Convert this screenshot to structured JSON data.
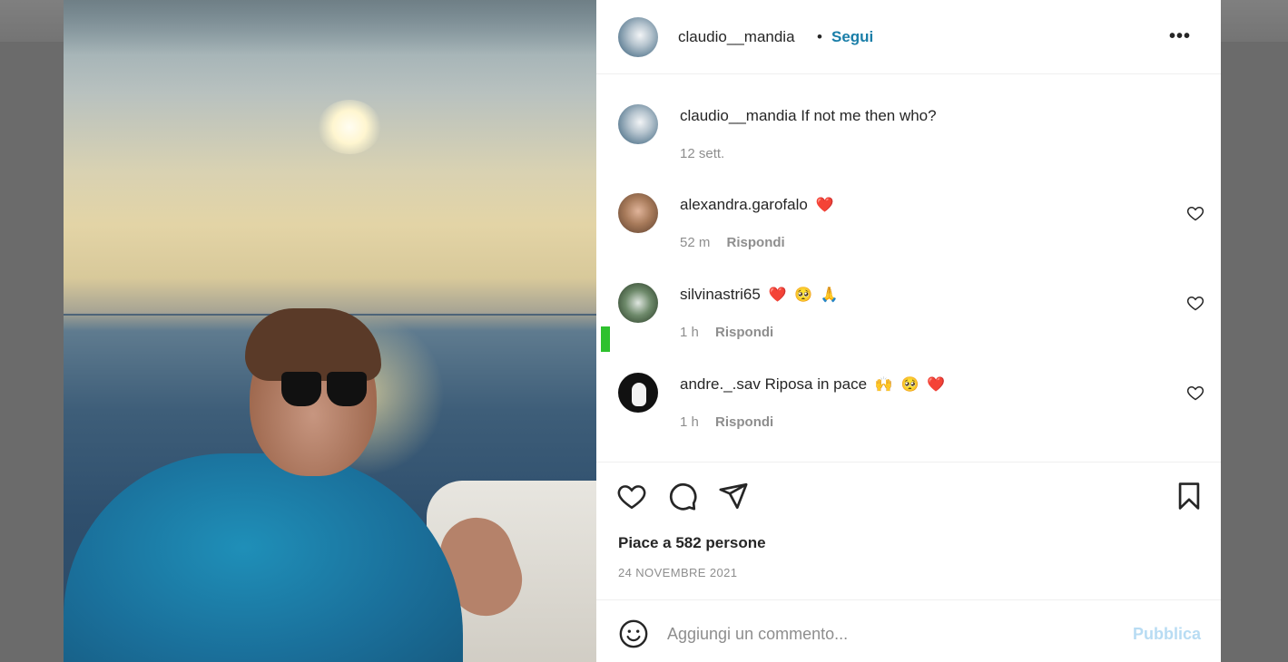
{
  "post_header": {
    "username": "claudio__mandia",
    "separator": "•",
    "follow_label": "Segui",
    "more_label": "•••"
  },
  "caption": {
    "username": "claudio__mandia",
    "text": "If not me then who?",
    "time": "12 sett."
  },
  "comments": [
    {
      "username": "alexandra.garofalo",
      "text": "",
      "emojis": [
        "❤️"
      ],
      "time": "52 m",
      "reply_label": "Rispondi"
    },
    {
      "username": "silvinastri65",
      "text": "",
      "emojis": [
        "❤️",
        "🥺",
        "🙏"
      ],
      "time": "1 h",
      "reply_label": "Rispondi"
    },
    {
      "username": "andre._.sav",
      "text": "Riposa in pace",
      "emojis": [
        "🙌",
        "🥺",
        "❤️"
      ],
      "time": "1 h",
      "reply_label": "Rispondi"
    }
  ],
  "actions": {
    "likes_text": "Piace a 582 persone",
    "date": "24 NOVEMBRE 2021"
  },
  "add_comment": {
    "placeholder": "Aggiungi un commento...",
    "publish_label": "Pubblica"
  },
  "icons": {
    "like": "heart-icon",
    "comment": "comment-icon",
    "share": "share-icon",
    "save": "bookmark-icon",
    "emoji": "smiley-icon",
    "options": "more-icon"
  },
  "colors": {
    "follow": "#1a7ea8",
    "publish_disabled": "#b8dcf3",
    "secondary_text": "#8e8e8e",
    "primary_text": "#262626"
  }
}
